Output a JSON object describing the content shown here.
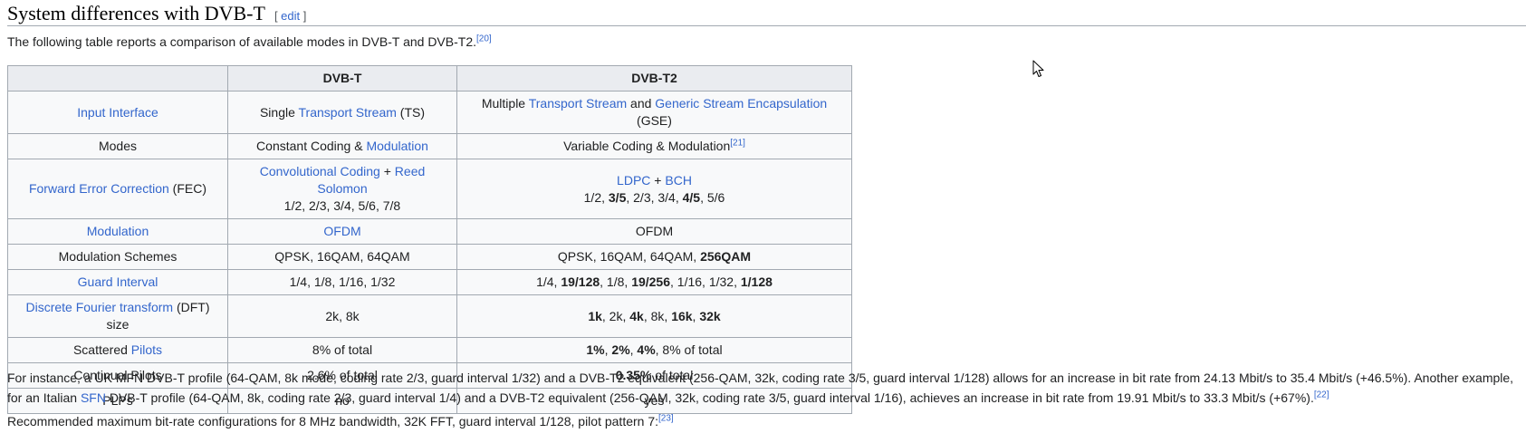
{
  "heading": {
    "title": "System differences with DVB-T",
    "edit_open": "[ ",
    "edit_label": "edit",
    "edit_close": " ]"
  },
  "intro": {
    "text": "The following table reports a comparison of available modes in DVB-T and DVB-T2.",
    "ref": "[20]"
  },
  "table": {
    "headers": [
      "",
      "DVB-T",
      "DVB-T2"
    ],
    "rows": [
      {
        "label": [
          {
            "t": "Input Interface",
            "link": true
          }
        ],
        "t": [
          {
            "t": "Single "
          },
          {
            "t": "Transport Stream",
            "link": true
          },
          {
            "t": " (TS)"
          }
        ],
        "t2": [
          {
            "t": "Multiple "
          },
          {
            "t": "Transport Stream",
            "link": true
          },
          {
            "t": " and "
          },
          {
            "t": "Generic Stream Encapsulation",
            "link": true
          },
          {
            "t": " (GSE)"
          }
        ]
      },
      {
        "label": [
          {
            "t": "Modes"
          }
        ],
        "t": [
          {
            "t": "Constant Coding & "
          },
          {
            "t": "Modulation",
            "link": true
          }
        ],
        "t2": [
          {
            "t": "Variable Coding & Modulation"
          },
          {
            "t": "[21]",
            "sup": true,
            "link": true
          }
        ]
      },
      {
        "label": [
          {
            "t": "Forward Error Correction",
            "link": true
          },
          {
            "t": " (FEC)"
          }
        ],
        "t": [
          {
            "t": "Convolutional Coding",
            "link": true
          },
          {
            "t": " + "
          },
          {
            "t": "Reed Solomon",
            "link": true
          },
          {
            "br": true
          },
          {
            "t": "1/2, 2/3, 3/4, 5/6, 7/8"
          }
        ],
        "t2": [
          {
            "t": "LDPC",
            "link": true
          },
          {
            "t": " + "
          },
          {
            "t": "BCH",
            "link": true
          },
          {
            "br": true
          },
          {
            "t": "1/2, "
          },
          {
            "t": "3/5",
            "bold": true
          },
          {
            "t": ", 2/3, 3/4, "
          },
          {
            "t": "4/5",
            "bold": true
          },
          {
            "t": ", 5/6"
          }
        ]
      },
      {
        "label": [
          {
            "t": "Modulation",
            "link": true
          }
        ],
        "t": [
          {
            "t": "OFDM",
            "link": true
          }
        ],
        "t2": [
          {
            "t": "OFDM"
          }
        ]
      },
      {
        "label": [
          {
            "t": "Modulation Schemes"
          }
        ],
        "t": [
          {
            "t": "QPSK, 16QAM, 64QAM"
          }
        ],
        "t2": [
          {
            "t": "QPSK, 16QAM, 64QAM, "
          },
          {
            "t": "256QAM",
            "bold": true
          }
        ]
      },
      {
        "label": [
          {
            "t": "Guard Interval",
            "link": true
          }
        ],
        "t": [
          {
            "t": "1/4, 1/8, 1/16, 1/32"
          }
        ],
        "t2": [
          {
            "t": "1/4, "
          },
          {
            "t": "19/128",
            "bold": true
          },
          {
            "t": ", 1/8, "
          },
          {
            "t": "19/256",
            "bold": true
          },
          {
            "t": ", 1/16, 1/32, "
          },
          {
            "t": "1/128",
            "bold": true
          }
        ]
      },
      {
        "label": [
          {
            "t": "Discrete Fourier transform",
            "link": true
          },
          {
            "t": " (DFT) size"
          }
        ],
        "t": [
          {
            "t": "2k, 8k"
          }
        ],
        "t2": [
          {
            "t": "1k",
            "bold": true
          },
          {
            "t": ", 2k, "
          },
          {
            "t": "4k",
            "bold": true
          },
          {
            "t": ", 8k, "
          },
          {
            "t": "16k",
            "bold": true
          },
          {
            "t": ", "
          },
          {
            "t": "32k",
            "bold": true
          }
        ]
      },
      {
        "label": [
          {
            "t": "Scattered "
          },
          {
            "t": "Pilots",
            "link": true
          }
        ],
        "t": [
          {
            "t": "8% of total"
          }
        ],
        "t2": [
          {
            "t": "1%",
            "bold": true
          },
          {
            "t": ", "
          },
          {
            "t": "2%",
            "bold": true
          },
          {
            "t": ", "
          },
          {
            "t": "4%",
            "bold": true
          },
          {
            "t": ", 8% of total"
          }
        ]
      },
      {
        "label": [
          {
            "t": "Continual Pilots"
          }
        ],
        "t": [
          {
            "t": "2.6% of total"
          }
        ],
        "t2": [
          {
            "t": "0.35%",
            "bold": true
          },
          {
            "t": " of total"
          }
        ]
      },
      {
        "label": [
          {
            "t": "PLPs"
          }
        ],
        "t": [
          {
            "t": "no"
          }
        ],
        "t2": [
          {
            "t": "yes"
          }
        ]
      }
    ]
  },
  "para1": [
    {
      "t": "For instance, a UK MFN DVB-T profile (64-QAM, 8k mode, coding rate 2/3, guard interval 1/32) and a DVB-T2 equivalent (256-QAM, 32k, coding rate 3/5, guard interval 1/128) allows for an increase in bit rate from 24.13 Mbit/s to 35.4 Mbit/s (+46.5%). Another example, for an Italian "
    },
    {
      "t": "SFN",
      "link": true
    },
    {
      "t": " DVB-T profile (64-QAM, 8k, coding rate 2/3, guard interval 1/4) and a DVB-T2 equivalent (256-QAM, 32k, coding rate 3/5, guard interval 1/16), achieves an increase in bit rate from 19.91 Mbit/s to 33.3 Mbit/s (+67%)."
    },
    {
      "t": "[22]",
      "sup": true,
      "link": true
    }
  ],
  "para2": [
    {
      "t": "Recommended maximum bit-rate configurations for 8 MHz bandwidth, 32K FFT, guard interval 1/128, pilot pattern 7:"
    },
    {
      "t": "[23]",
      "sup": true,
      "link": true
    }
  ],
  "icons": {
    "cursor": "mouse-pointer-icon"
  }
}
